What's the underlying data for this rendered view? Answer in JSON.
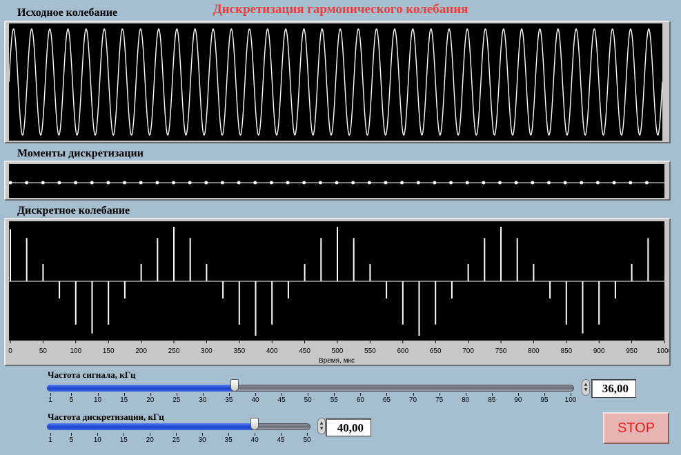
{
  "title": "Дискретизация гармонического колебания",
  "panels": {
    "original": {
      "label": "Исходное колебание"
    },
    "sampling": {
      "label": "Моменты дискретизации"
    },
    "discrete": {
      "label": "Дискретное колебание"
    }
  },
  "chart_data": [
    {
      "type": "line",
      "title": "Исходное колебание",
      "x_range_us": [
        0,
        1000
      ],
      "signal_freq_khz": 36,
      "note_color": "#ffffff"
    },
    {
      "type": "scatter",
      "title": "Моменты дискретизации",
      "x_range_us": [
        0,
        1000
      ],
      "sampling_freq_khz": 40
    },
    {
      "type": "bar",
      "title": "Дискретное колебание",
      "xlabel": "Время, мкс",
      "xlim": [
        0,
        1000
      ],
      "ylim": [
        -1,
        1
      ],
      "x_ticks": [
        0,
        50,
        100,
        150,
        200,
        250,
        300,
        350,
        400,
        450,
        500,
        550,
        600,
        650,
        700,
        750,
        800,
        850,
        900,
        950,
        1000
      ],
      "x": [
        0,
        25,
        50,
        75,
        100,
        125,
        150,
        175,
        200,
        225,
        250,
        275,
        300,
        325,
        350,
        375,
        400,
        425,
        450,
        475,
        500,
        525,
        550,
        575,
        600,
        625,
        650,
        675,
        700,
        725,
        750,
        775,
        800,
        825,
        850,
        875,
        900,
        925,
        950,
        975
      ],
      "values": [
        0.88,
        0.73,
        0.29,
        -0.29,
        -0.73,
        -0.88,
        -0.73,
        -0.29,
        0.29,
        0.73,
        0.92,
        0.73,
        0.29,
        -0.29,
        -0.73,
        -0.92,
        -0.73,
        -0.29,
        0.29,
        0.73,
        0.92,
        0.73,
        0.29,
        -0.29,
        -0.73,
        -0.92,
        -0.73,
        -0.29,
        0.29,
        0.73,
        0.92,
        0.73,
        0.29,
        -0.29,
        -0.73,
        -0.88,
        -0.73,
        -0.29,
        0.29,
        0.73
      ]
    }
  ],
  "controls": {
    "signal_freq": {
      "label": "Частота сигнала, кГц",
      "value": 36,
      "display": "36,00",
      "min": 1,
      "max": 100,
      "ticks": [
        1,
        5,
        10,
        15,
        20,
        25,
        30,
        35,
        40,
        45,
        50,
        55,
        60,
        65,
        70,
        75,
        80,
        85,
        90,
        95,
        100
      ]
    },
    "sampling_freq": {
      "label": "Частота дискретизации, кГц",
      "value": 40,
      "display": "40,00",
      "min": 1,
      "max": 50,
      "ticks": [
        1,
        5,
        10,
        15,
        20,
        25,
        30,
        35,
        40,
        45,
        50
      ]
    },
    "stop_label": "STOP"
  }
}
